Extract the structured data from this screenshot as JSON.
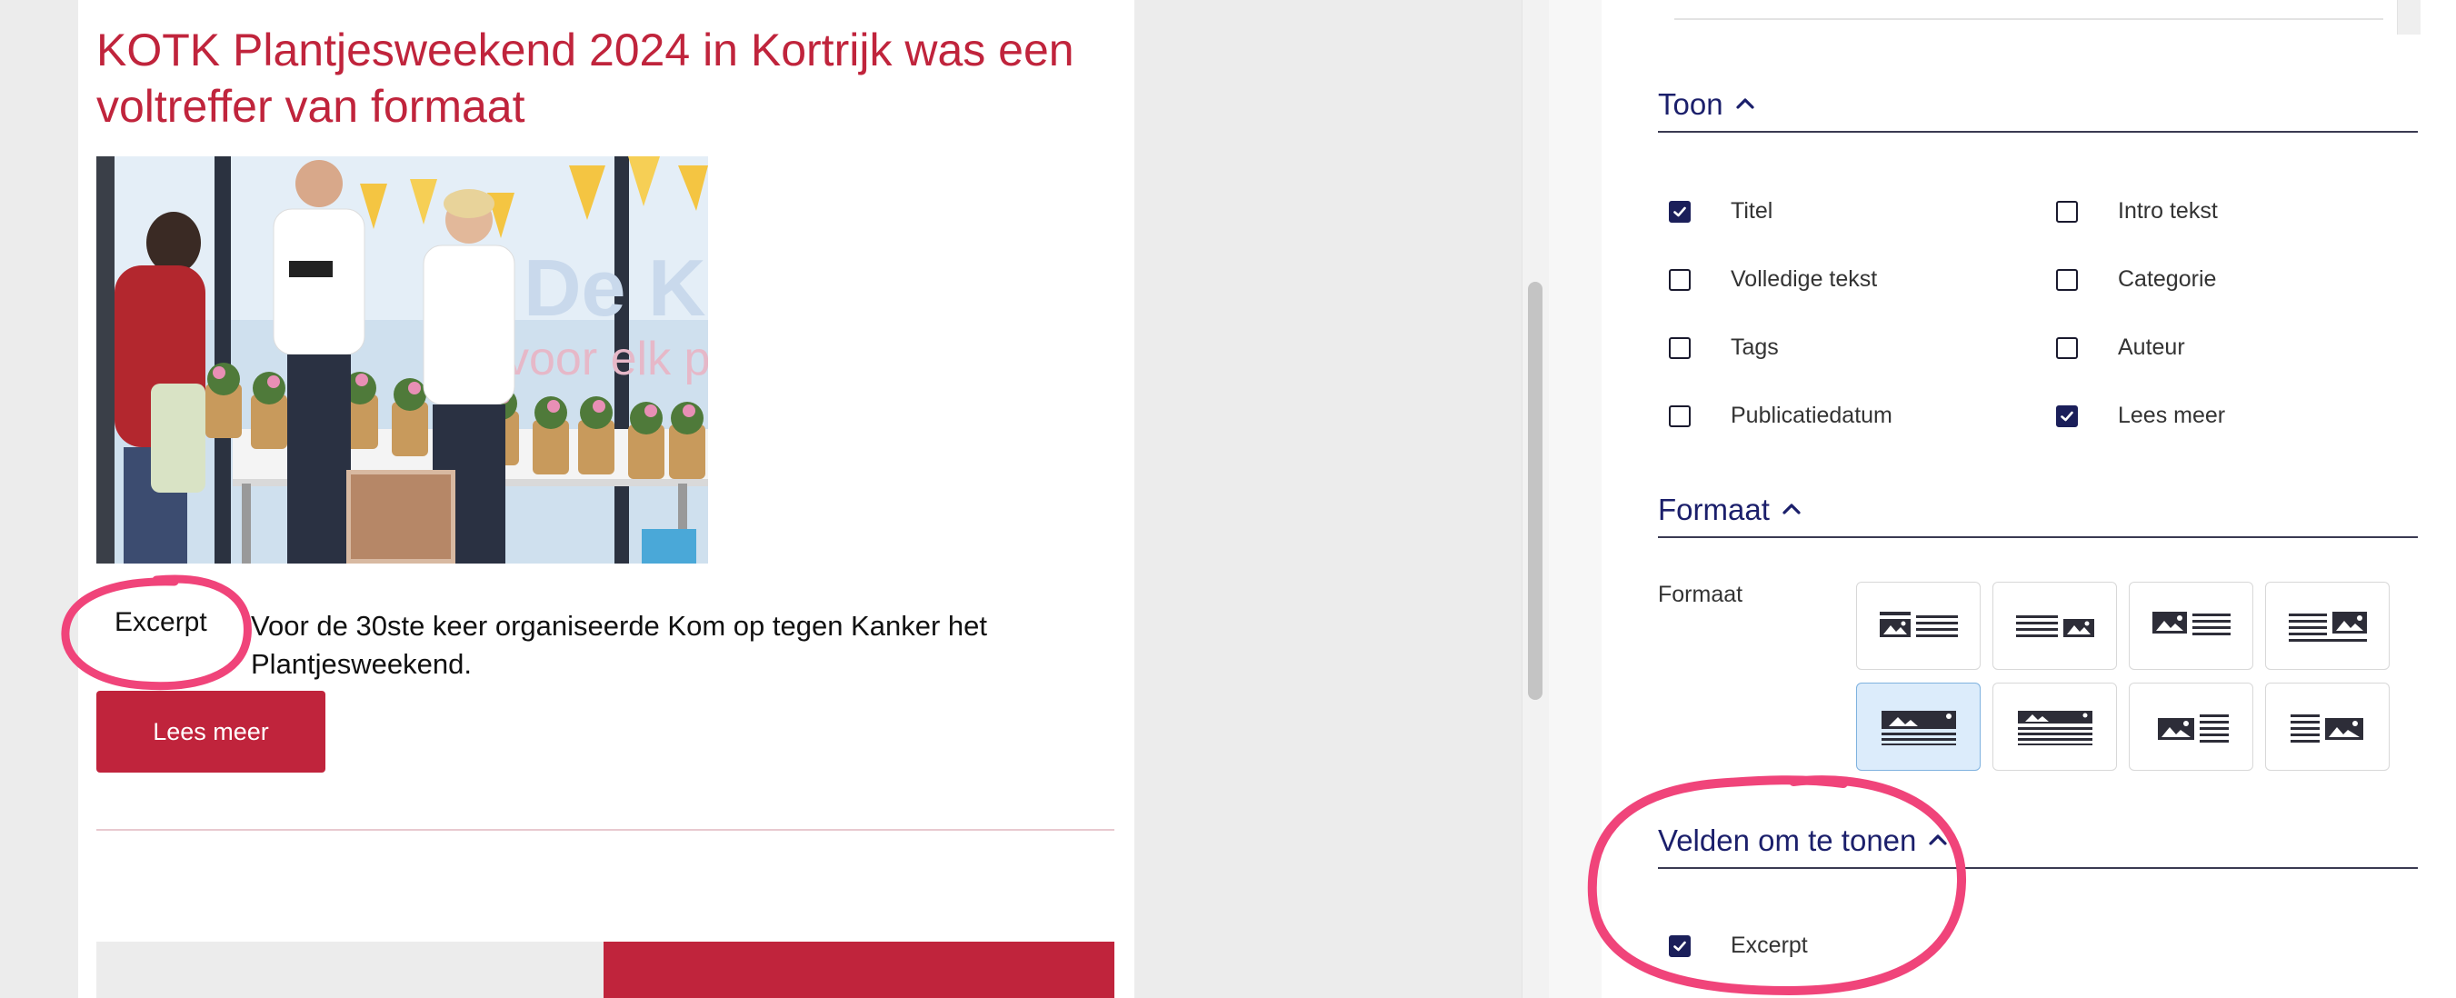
{
  "preview": {
    "title": "KOTK Plantjesweekend 2024 in Kortrijk was een voltreffer van formaat",
    "excerpt_label": "Excerpt",
    "excerpt_text": "Voor de 30ste keer organiseerde Kom op tegen Kanker het Plantjesweekend.",
    "read_more": "Lees meer",
    "colors": {
      "accent": "#c0243c"
    }
  },
  "settings": {
    "toon": {
      "heading": "Toon",
      "options": [
        {
          "label": "Titel",
          "checked": true
        },
        {
          "label": "Intro tekst",
          "checked": false
        },
        {
          "label": "Volledige tekst",
          "checked": false
        },
        {
          "label": "Categorie",
          "checked": false
        },
        {
          "label": "Tags",
          "checked": false
        },
        {
          "label": "Auteur",
          "checked": false
        },
        {
          "label": "Publicatiedatum",
          "checked": false
        },
        {
          "label": "Lees meer",
          "checked": true
        }
      ]
    },
    "formaat": {
      "heading": "Formaat",
      "field_label": "Formaat",
      "layouts": [
        {
          "icon": "image-left-text-right",
          "selected": false
        },
        {
          "icon": "text-left-image-right",
          "selected": false
        },
        {
          "icon": "image-left-text-right-bold",
          "selected": false
        },
        {
          "icon": "text-left-image-right-bold",
          "selected": false
        },
        {
          "icon": "image-top-text-below",
          "selected": true
        },
        {
          "icon": "image-top-text-below-alt",
          "selected": false
        },
        {
          "icon": "image-left-lines-right",
          "selected": false
        },
        {
          "icon": "lines-left-image-right",
          "selected": false
        }
      ]
    },
    "velden": {
      "heading": "Velden om te tonen",
      "options": [
        {
          "label": "Excerpt",
          "checked": true
        }
      ]
    },
    "colors": {
      "heading": "#1b1f6b",
      "checkbox_on": "#1b1f5a",
      "annotation": "#f0447a"
    }
  }
}
